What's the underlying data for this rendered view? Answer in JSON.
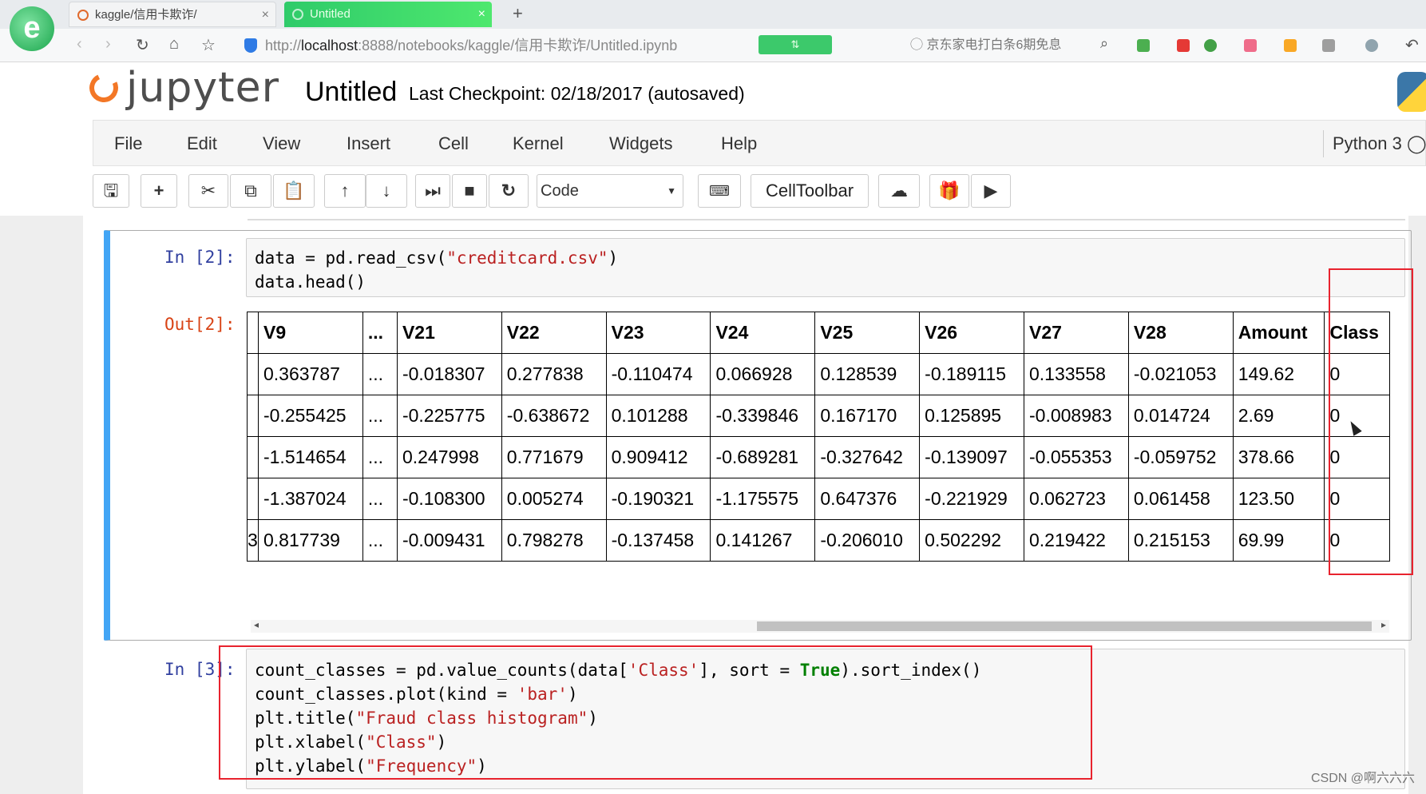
{
  "browser": {
    "tabs": [
      {
        "label": "kaggle/信用卡欺诈/",
        "close": "×"
      },
      {
        "label": "Untitled",
        "close": "×"
      }
    ],
    "new_tab": "+",
    "url_prefix": "http://",
    "url_host": "localhost",
    "url_path": ":8888/notebooks/kaggle/信用卡欺诈/Untitled.ipynb",
    "search_hint": "京东家电打白条6期免息",
    "nav": {
      "back": "‹",
      "forward": "›",
      "reload": "↻",
      "home": "⌂",
      "star": "☆",
      "undo": "↶"
    }
  },
  "jupyter": {
    "logo_text": "jupyter",
    "notebook_title": "Untitled",
    "checkpoint": "Last Checkpoint: 02/18/2017 (autosaved)",
    "kernel": "Python 3"
  },
  "menu": [
    "File",
    "Edit",
    "View",
    "Insert",
    "Cell",
    "Kernel",
    "Widgets",
    "Help"
  ],
  "toolbar": {
    "cell_type": "Code",
    "celltoolbar_label": "CellToolbar",
    "icons": [
      "save-icon",
      "plus-icon",
      "cut-icon",
      "copy-icon",
      "paste-icon",
      "arrow-up-icon",
      "arrow-down-icon",
      "run-icon",
      "stop-icon",
      "restart-icon",
      "keyboard-icon",
      "cloud-upload-icon",
      "gift-icon",
      "video-icon"
    ]
  },
  "cells": {
    "cell2": {
      "in_prompt": "In [2]:",
      "out_prompt": "Out[2]:",
      "line1_a": "data = pd.read_csv(",
      "line1_str": "\"creditcard.csv\"",
      "line1_b": ")",
      "line2": "data.head()"
    },
    "cell3": {
      "in_prompt": "In [3]:",
      "line1_a": "count_classes = pd.value_counts(data[",
      "line1_str": "'Class'",
      "line1_b": "], sort = ",
      "line1_kw": "True",
      "line1_c": ").sort_index()",
      "line2_a": "count_classes.plot(kind = ",
      "line2_str": "'bar'",
      "line2_b": ")",
      "line3_a": "plt.title(",
      "line3_str": "\"Fraud class histogram\"",
      "line3_b": ")",
      "line4_a": "plt.xlabel(",
      "line4_str": "\"Class\"",
      "line4_b": ")",
      "line5_a": "plt.ylabel(",
      "line5_str": "\"Frequency\"",
      "line5_b": ")"
    }
  },
  "table": {
    "headers": [
      "V9",
      "...",
      "V21",
      "V22",
      "V23",
      "V24",
      "V25",
      "V26",
      "V27",
      "V28",
      "Amount",
      "Class"
    ],
    "rows": [
      {
        "idx": "",
        "cells": [
          "0.363787",
          "...",
          "-0.018307",
          "0.277838",
          "-0.110474",
          "0.066928",
          "0.128539",
          "-0.189115",
          "0.133558",
          "-0.021053",
          "149.62",
          "0"
        ]
      },
      {
        "idx": "",
        "cells": [
          "-0.255425",
          "...",
          "-0.225775",
          "-0.638672",
          "0.101288",
          "-0.339846",
          "0.167170",
          "0.125895",
          "-0.008983",
          "0.014724",
          "2.69",
          "0"
        ]
      },
      {
        "idx": "",
        "cells": [
          "-1.514654",
          "...",
          "0.247998",
          "0.771679",
          "0.909412",
          "-0.689281",
          "-0.327642",
          "-0.139097",
          "-0.055353",
          "-0.059752",
          "378.66",
          "0"
        ]
      },
      {
        "idx": "",
        "cells": [
          "-1.387024",
          "...",
          "-0.108300",
          "0.005274",
          "-0.190321",
          "-1.175575",
          "0.647376",
          "-0.221929",
          "0.062723",
          "0.061458",
          "123.50",
          "0"
        ]
      },
      {
        "idx": "3",
        "cells": [
          "0.817739",
          "...",
          "-0.009431",
          "0.798278",
          "-0.137458",
          "0.141267",
          "-0.206010",
          "0.502292",
          "0.219422",
          "0.215153",
          "69.99",
          "0"
        ]
      }
    ]
  },
  "watermark": "CSDN @啊六六六"
}
